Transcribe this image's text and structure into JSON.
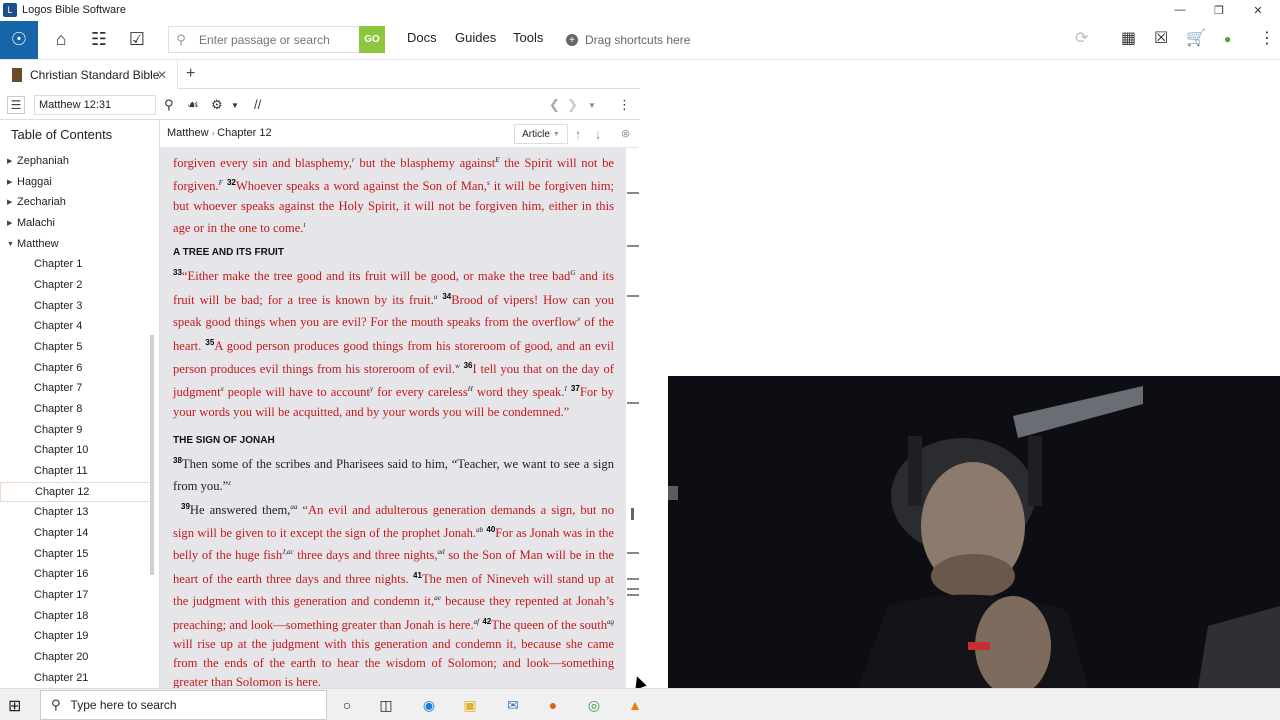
{
  "window": {
    "title": "Logos Bible Software"
  },
  "toolbar": {
    "search_placeholder": "Enter passage or search",
    "go_label": "GO",
    "links": [
      "Docs",
      "Guides",
      "Tools"
    ],
    "shortcuts_label": "Drag shortcuts here"
  },
  "tab": {
    "label": "Christian Standard Bible"
  },
  "panel": {
    "reference": "Matthew 12:31"
  },
  "toc": {
    "title": "Table of Contents",
    "books": [
      "Zephaniah",
      "Haggai",
      "Zechariah",
      "Malachi",
      "Matthew"
    ],
    "chapters": [
      "Chapter 1",
      "Chapter 2",
      "Chapter 3",
      "Chapter 4",
      "Chapter 5",
      "Chapter 6",
      "Chapter 7",
      "Chapter 8",
      "Chapter 9",
      "Chapter 10",
      "Chapter 11",
      "Chapter 12",
      "Chapter 13",
      "Chapter 14",
      "Chapter 15",
      "Chapter 16",
      "Chapter 17",
      "Chapter 18",
      "Chapter 19",
      "Chapter 20",
      "Chapter 21"
    ],
    "selected": "Chapter 12"
  },
  "doc": {
    "crumb_book": "Matthew",
    "crumb_chapter": "Chapter 12",
    "view_mode": "Article",
    "p1": {
      "t1": "forgiven every sin and blasphemy,",
      "f1": "r",
      "t2": " but the blasphemy against",
      "f2": "E",
      "t3": " the Spirit will not be forgiven.",
      "f3": "F",
      "v32": "32",
      "t4": "Whoever speaks a word against the Son of Man,",
      "f4": "s",
      "t5": " it will be forgiven him; but whoever speaks against the Holy Spirit, it will not be forgiven him, either in this age or in the one to come.",
      "f5": "t"
    },
    "h1": "A TREE AND ITS FRUIT",
    "p2": {
      "v33": "33",
      "t1": "“Either make the tree good and its fruit will be good, or make the tree bad",
      "f1": "G",
      "t2": " and its fruit will be bad; for a tree is known by its fruit.",
      "f2": "u",
      "v34": "34",
      "t3": "Brood of vipers! How can you speak good things when you are evil? For the mouth speaks from the overflow",
      "f3": "v",
      "t4": " of the heart.",
      "v35": "35",
      "t5": "A good person produces good things from his storeroom of good, and an evil person produces evil things from his storeroom of evil.",
      "f4": "w",
      "v36": "36",
      "t6": "I tell you that on the day of judgment",
      "f5": "x",
      "t7": " people will have to account",
      "f6": "y",
      "t8": " for every careless",
      "f7": "H",
      "t9": " word they speak.",
      "f8": "I",
      "v37": "37",
      "t10": "For by your words you will be acquitted, and by your words you will be condemned.”"
    },
    "h2": "THE SIGN OF JONAH",
    "p3": {
      "v38": "38",
      "t1": "Then some of the scribes and Pharisees said to him, “Teacher, we want to see a sign from you.”",
      "f1": "z"
    },
    "p4": {
      "v39": "39",
      "t1": "He answered them,",
      "f1": "aa",
      "t2": " “An evil and adulterous generation demands a sign, but no sign will be given to it except the sign of the prophet Jonah.",
      "f2": "ab",
      "v40": "40",
      "t3": "For as Jonah was in the belly of the huge fish",
      "f3": "J,ac",
      "t4": " three days and three nights,",
      "f4": "ad",
      "t5": " so the Son of Man will be in the heart of the earth three days and three nights.",
      "v41": "41",
      "t6": "The men of Nineveh will stand up at the judgment with this generation and condemn it,",
      "f5": "ae",
      "t7": " because they repented at Jonah’s preaching; and look—something greater than Jonah is here.",
      "f6": "af",
      "v42": "42",
      "t8": "The queen of the south",
      "f7": "ag",
      "t9": " will rise up at the judgment with this generation and condemn it, because she came from the ends of the earth to hear the wisdom of Solomon; and look—something greater than Solomon is here."
    }
  },
  "taskbar": {
    "search_label": "Type here to search"
  },
  "colors": {
    "accent": "#1565a8",
    "go": "#8cc63f",
    "words_of_christ": "#c41a1a"
  }
}
